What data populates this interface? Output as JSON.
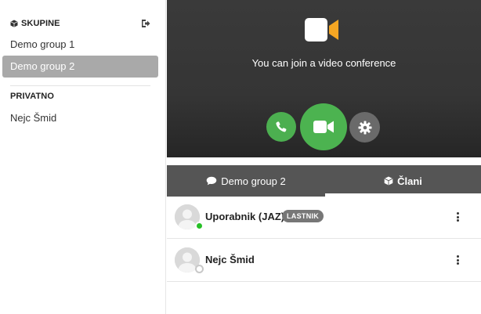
{
  "sidebar": {
    "groups_header": "SKUPINE",
    "groups": [
      {
        "label": "Demo group 1",
        "active": false
      },
      {
        "label": "Demo group 2",
        "active": true
      }
    ],
    "private_header": "PRIVATNO",
    "private": [
      {
        "label": "Nejc Šmid"
      }
    ]
  },
  "video": {
    "message": "You can join a video conference",
    "icons": {
      "camera": "video-camera-icon",
      "phone": "phone-icon",
      "video": "video-icon",
      "settings": "gear-icon"
    },
    "colors": {
      "green": "#4caf50",
      "gray": "#6a6a6a"
    }
  },
  "tabs": [
    {
      "label": "Demo group 2",
      "icon": "chat-icon",
      "active": false
    },
    {
      "label": "Člani",
      "icon": "cube-icon",
      "active": true
    }
  ],
  "members": [
    {
      "name": "Uporabnik (JAZ)",
      "badge": "LASTNIK",
      "status": "online"
    },
    {
      "name": "Nejc Šmid",
      "badge": "",
      "status": "offline"
    }
  ]
}
